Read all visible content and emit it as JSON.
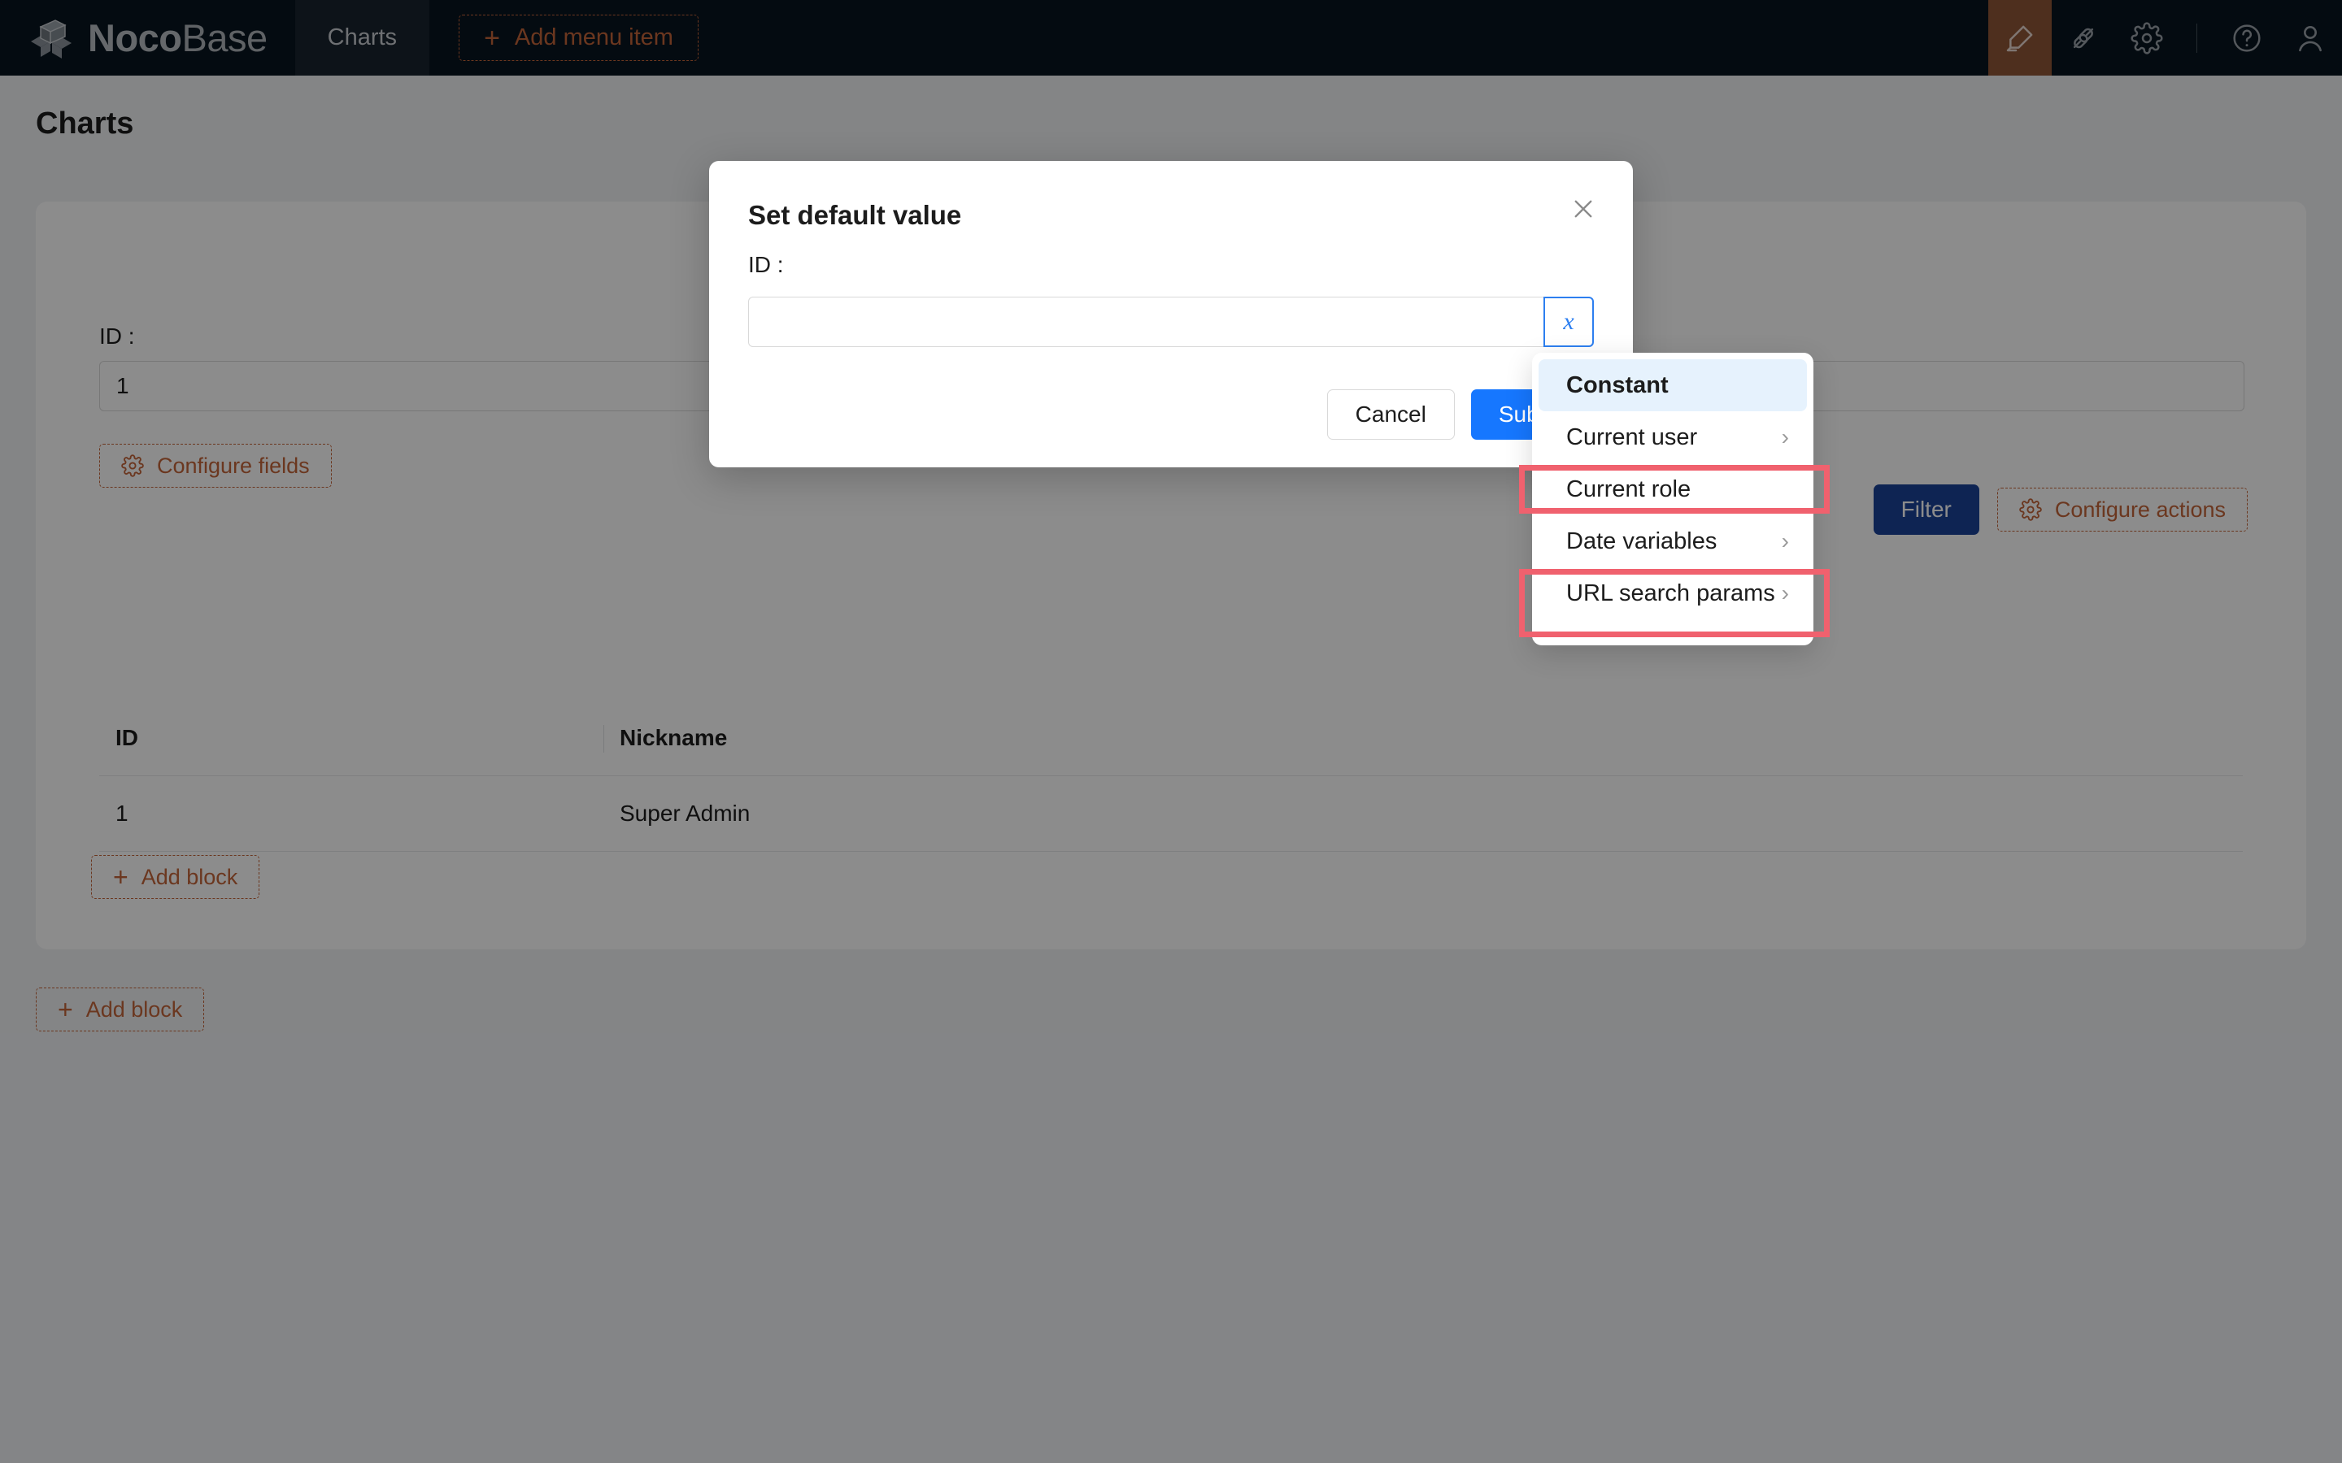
{
  "topbar": {
    "brand_bold": "Noco",
    "brand_light": "Base",
    "active_tab": "Charts",
    "add_menu_item_label": "Add menu item",
    "plus_glyph": "+",
    "icons": [
      {
        "name": "highlighter-icon",
        "active": true
      },
      {
        "name": "plugin-icon",
        "active": false
      },
      {
        "name": "gear-icon",
        "active": false
      },
      {
        "name": "help-circle-icon",
        "active": false
      },
      {
        "name": "user-avatar-icon",
        "active": false
      }
    ]
  },
  "page": {
    "title": "Charts",
    "form": {
      "id_label": "ID :",
      "id_value": "1",
      "id_placeholder": ""
    },
    "configure_fields_label": "Configure fields",
    "filter_label": "Filter",
    "configure_actions_label": "Configure actions",
    "add_block_label": "Add block",
    "table": {
      "columns": [
        "ID",
        "Nickname"
      ],
      "rows": [
        {
          "id": "1",
          "nickname": "Super Admin"
        }
      ]
    }
  },
  "modal": {
    "title": "Set default value",
    "close_icon": "close-icon",
    "field_label": "ID :",
    "field_value": "",
    "field_placeholder": "",
    "variable_toggle_glyph": "x",
    "cancel_label": "Cancel",
    "submit_label": "Submit"
  },
  "variable_menu": {
    "items": [
      {
        "label": "Constant",
        "has_submenu": false,
        "selected": true,
        "highlighted": false
      },
      {
        "label": "Current user",
        "has_submenu": true,
        "selected": false,
        "highlighted": false
      },
      {
        "label": "Current role",
        "has_submenu": false,
        "selected": false,
        "highlighted": true
      },
      {
        "label": "Date variables",
        "has_submenu": true,
        "selected": false,
        "highlighted": false
      },
      {
        "label": "URL search params",
        "has_submenu": true,
        "selected": false,
        "highlighted": true
      }
    ],
    "chevron_glyph": "›"
  },
  "colors": {
    "topbar_bg": "#081520",
    "accent_orange": "#c4653a",
    "primary_blue": "#1677ff",
    "filter_blue": "#1b4298",
    "annotation_red": "#f0616e",
    "menu_selected_bg": "#e6f2fd",
    "variable_border_blue": "#2d7ff0"
  }
}
